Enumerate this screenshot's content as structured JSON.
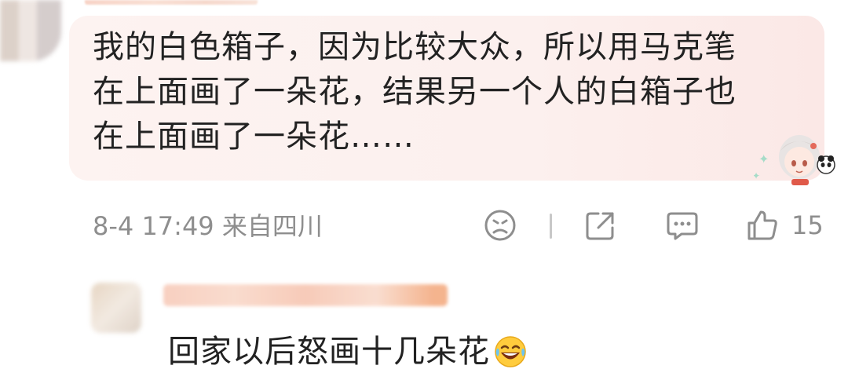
{
  "comment": {
    "lines": [
      "我的白色箱子，因为比较大众，所以用马克笔",
      "在上面画了一朵花，结果另一个人的白箱子也",
      "在上面画了一朵花……"
    ],
    "meta": "8-4 17:49 来自四川",
    "like_count": "15"
  },
  "reply": {
    "text": "回家以后怒画十几朵花"
  },
  "icons": {
    "dislike": "frown-face-icon",
    "share": "share-icon",
    "comment": "comment-icon",
    "like": "thumbs-up-icon",
    "reply_emoji": "laughing-crying-emoji-icon"
  },
  "colors": {
    "bubble": "#fdf3f1",
    "text": "#222222",
    "meta": "#8e8e8e"
  }
}
